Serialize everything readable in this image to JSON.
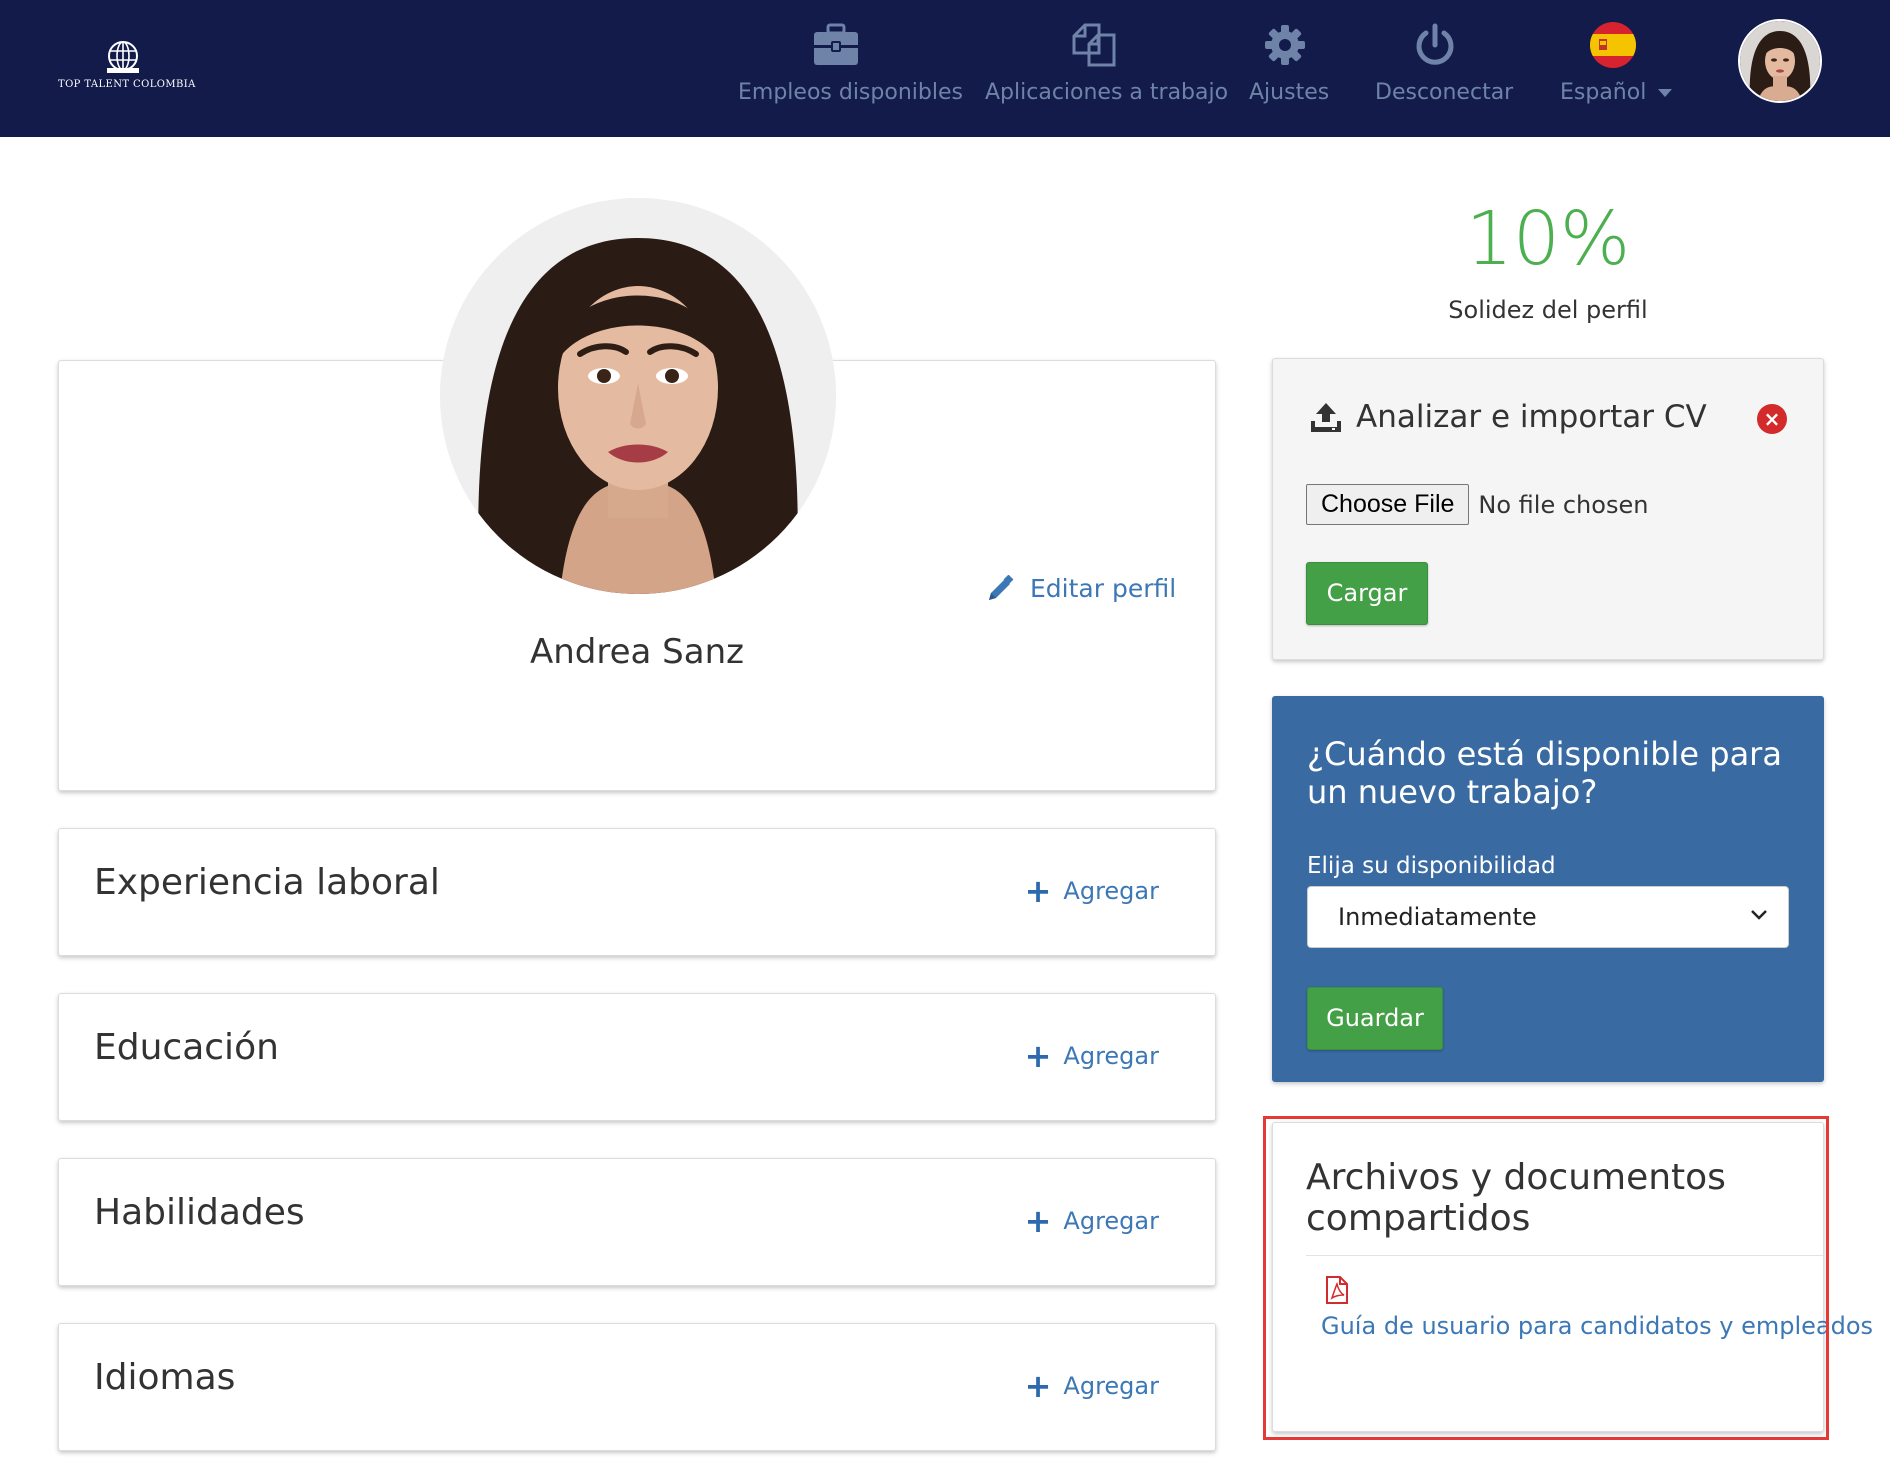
{
  "brand": {
    "name": "TOP TALENT COLOMBIA"
  },
  "nav": {
    "items": [
      {
        "label": "Empleos disponibles",
        "icon": "briefcase-icon"
      },
      {
        "label": "Aplicaciones a trabajo",
        "icon": "copy-documents-icon"
      },
      {
        "label": "Ajustes",
        "icon": "gear-icon"
      },
      {
        "label": "Desconectar",
        "icon": "power-icon"
      }
    ],
    "language": {
      "label": "Español",
      "flag": "spain-flag-icon"
    }
  },
  "profile": {
    "name": "Andrea Sanz",
    "edit_label": "Editar perfil"
  },
  "sections": [
    {
      "title": "Experiencia laboral",
      "add_label": "Agregar"
    },
    {
      "title": "Educación",
      "add_label": "Agregar"
    },
    {
      "title": "Habilidades",
      "add_label": "Agregar"
    },
    {
      "title": "Idiomas",
      "add_label": "Agregar"
    }
  ],
  "strength": {
    "percent_label": "10%",
    "percent_value": 10,
    "label": "Solidez del perfil"
  },
  "cv_import": {
    "title": "Analizar e importar CV",
    "choose_file_label": "Choose File",
    "file_status": "No file chosen",
    "upload_label": "Cargar"
  },
  "availability": {
    "title": "¿Cuándo está disponible para un nuevo trabajo?",
    "label": "Elija su disponibilidad",
    "selected": "Inmediatamente",
    "save_label": "Guardar"
  },
  "documents": {
    "title": "Archivos y documentos compartidos",
    "items": [
      {
        "label": "Guía de usuario para candidatos y empleados",
        "icon": "pdf-icon"
      }
    ]
  },
  "colors": {
    "navbar": "#121b4a",
    "nav_text": "#6f83a8",
    "link": "#3d78b6",
    "success": "#43a047",
    "strength": "#4caf50",
    "availability_panel": "#396aa2",
    "highlight": "#e53935"
  }
}
